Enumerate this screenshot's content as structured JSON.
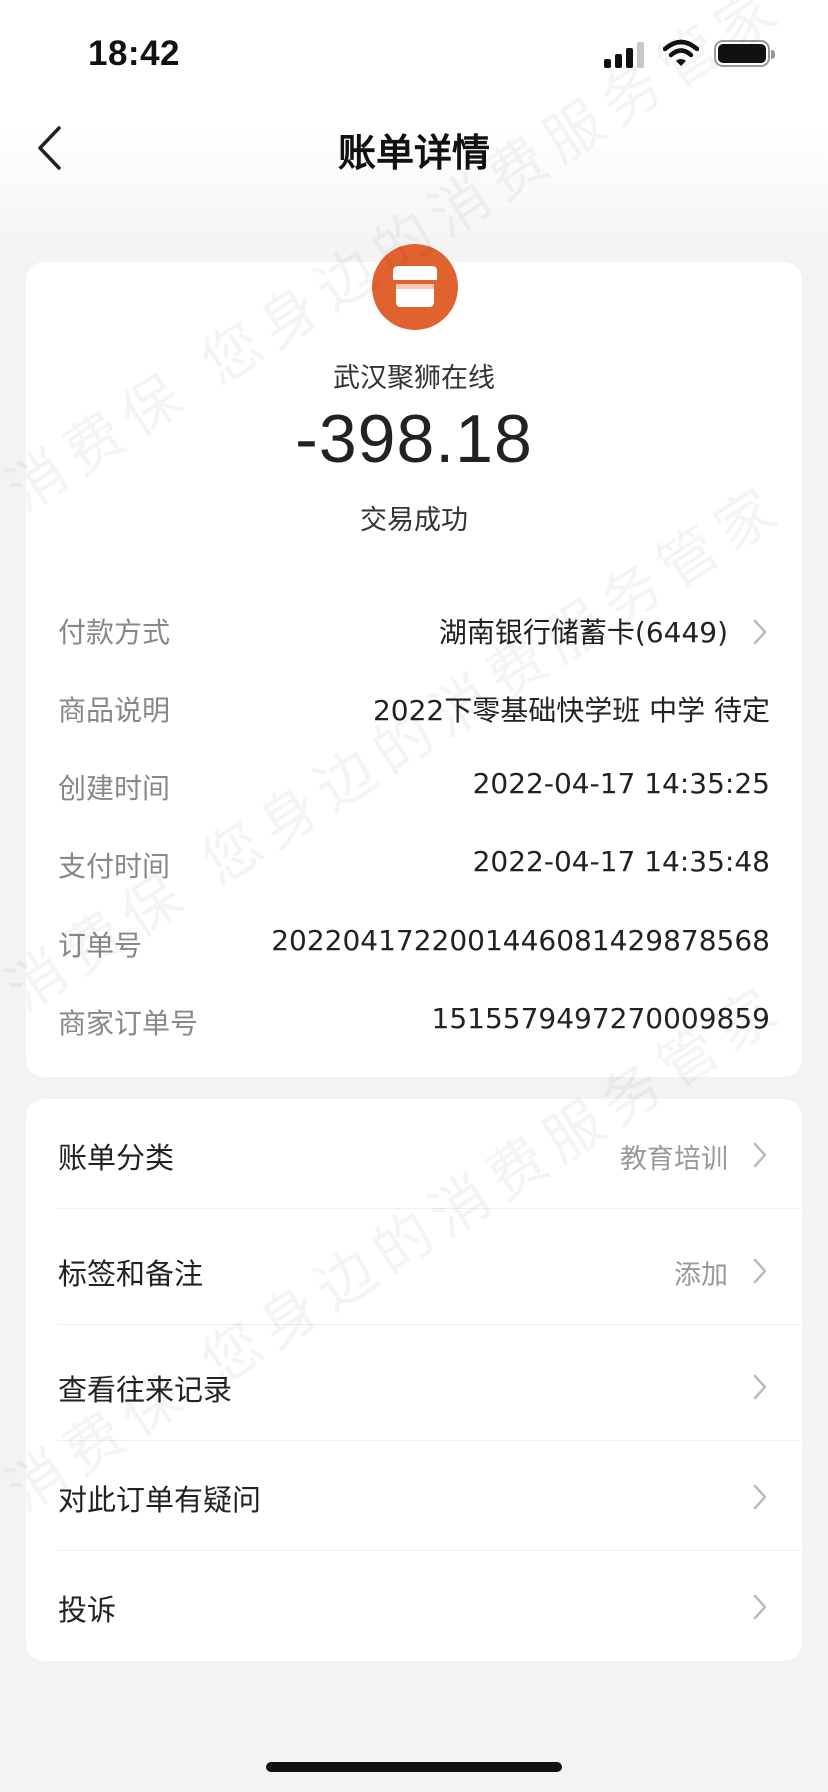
{
  "status_bar": {
    "time": "18:42"
  },
  "nav": {
    "title": "账单详情"
  },
  "merchant": {
    "name": "武汉聚狮在线",
    "amount": "-398.18",
    "status": "交易成功",
    "logo_color": "#e0622e"
  },
  "details": [
    {
      "label": "付款方式",
      "value": "湖南银行储蓄卡(6449)"
    },
    {
      "label": "商品说明",
      "value": "2022下零基础快学班 中学 待定"
    },
    {
      "label": "创建时间",
      "value": "2022-04-17 14:35:25"
    },
    {
      "label": "支付时间",
      "value": "2022-04-17 14:35:48"
    },
    {
      "label": "订单号",
      "value": "2022041722001446081429878568"
    },
    {
      "label": "商家订单号",
      "value": "1515579497270009859"
    }
  ],
  "actions": [
    {
      "label": "账单分类",
      "value": "教育培训"
    },
    {
      "label": "标签和备注",
      "value": "添加"
    },
    {
      "label": "查看往来记录",
      "value": ""
    },
    {
      "label": "对此订单有疑问",
      "value": ""
    },
    {
      "label": "投诉",
      "value": ""
    }
  ],
  "watermark": "消费保 您身边的消费服务管家"
}
